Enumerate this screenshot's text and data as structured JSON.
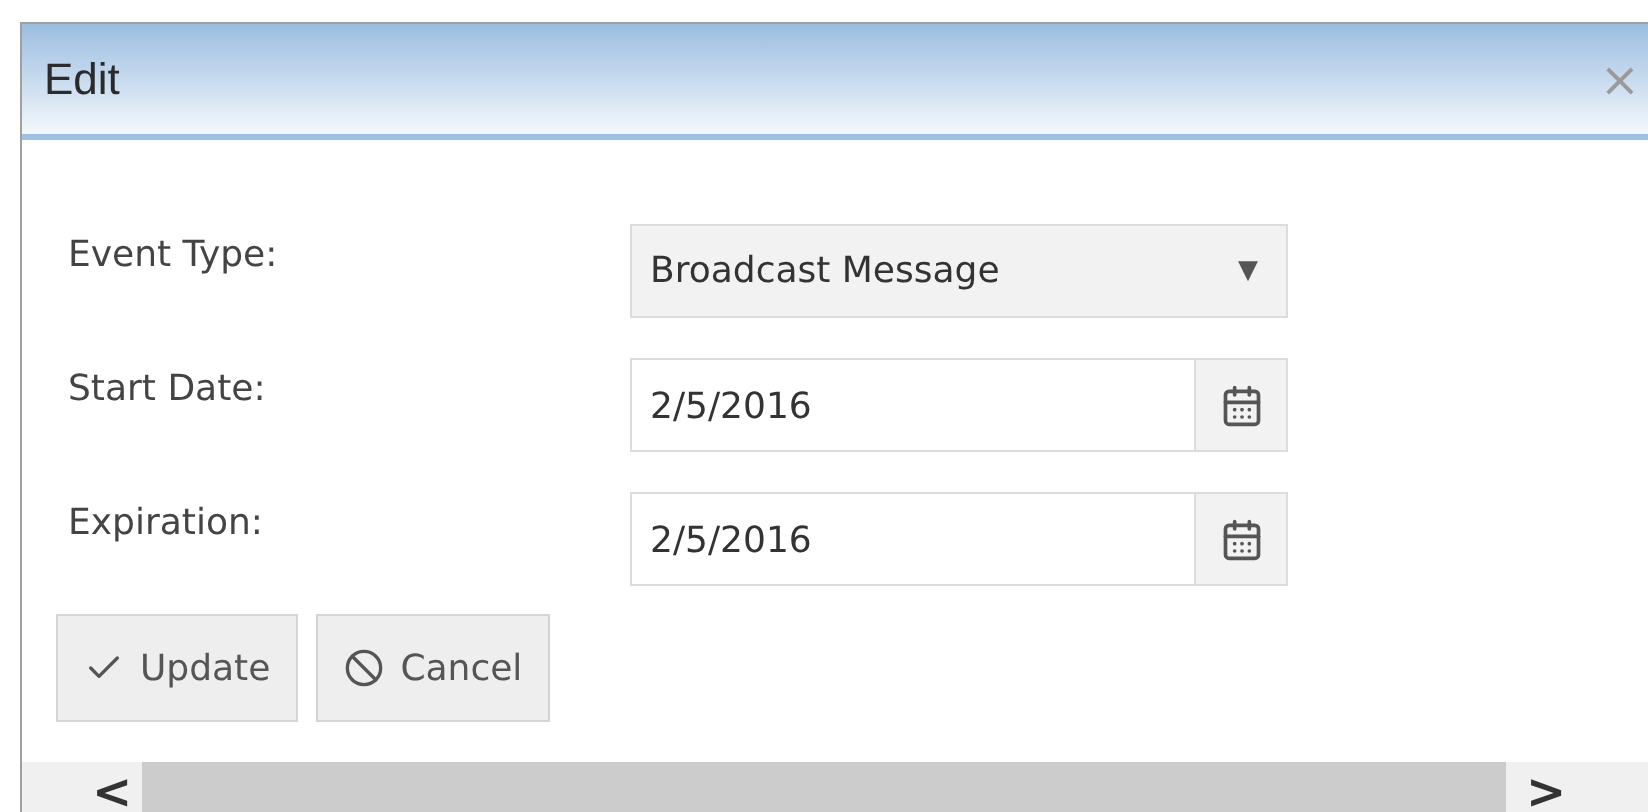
{
  "window": {
    "title": "Edit",
    "close": "×"
  },
  "fields": [
    {
      "kind": "dropdown",
      "label": "Event Type:",
      "value": "Broadcast Message",
      "arrow": "▼"
    },
    {
      "kind": "date",
      "label": "Start Date:",
      "value": "2/5/2016"
    },
    {
      "kind": "date",
      "label": "Expiration:",
      "value": "2/5/2016"
    }
  ],
  "buttons": [
    {
      "kind": "update",
      "label": "Update"
    },
    {
      "kind": "cancel",
      "label": "Cancel"
    }
  ],
  "scrollbar": {
    "left": "<",
    "right": ">"
  }
}
